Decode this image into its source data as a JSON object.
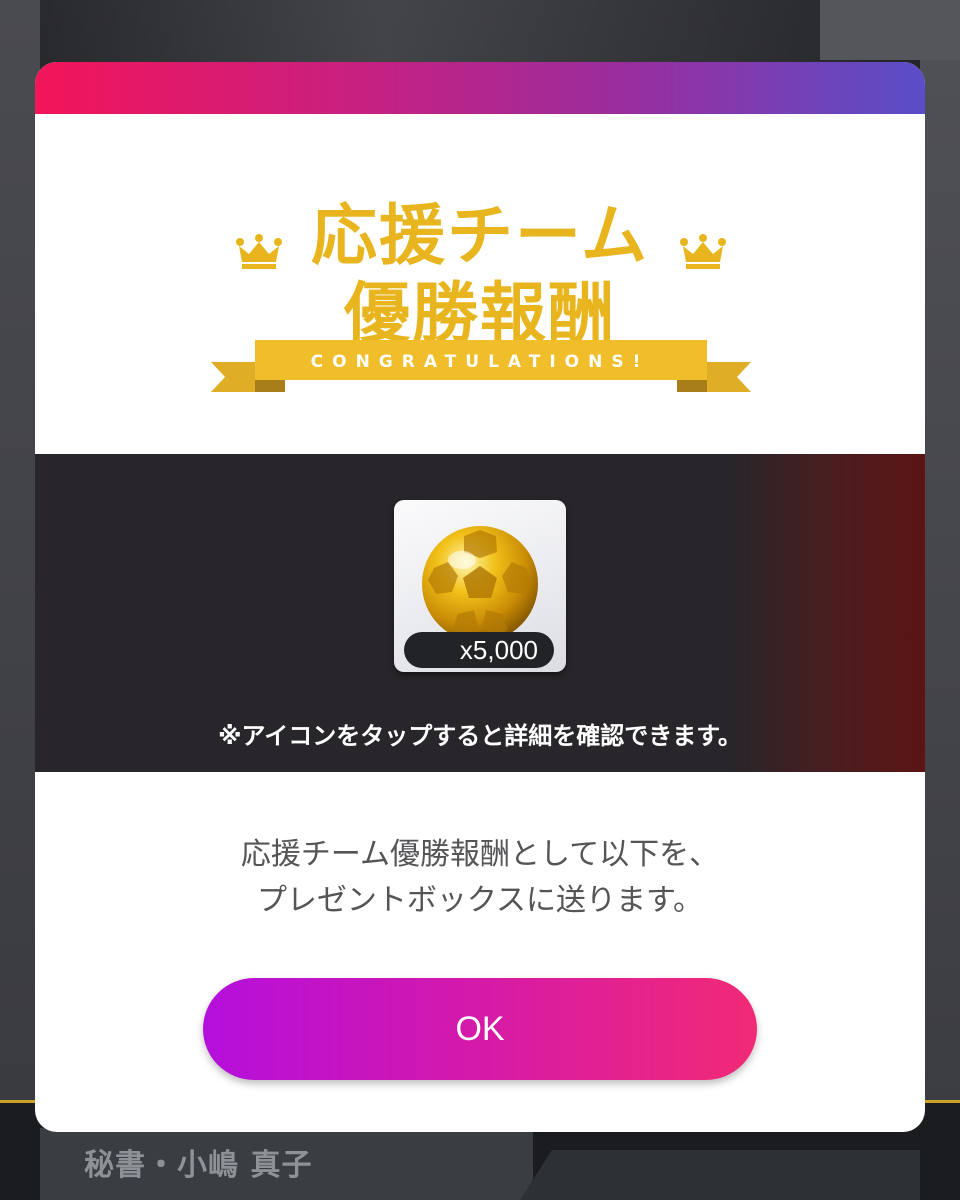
{
  "speaker": {
    "name": "秘書・小嶋 真子"
  },
  "dialog": {
    "title_line1": "応援チーム",
    "title_line2": "優勝報酬",
    "ribbon_text": "CONGRATULATIONS!",
    "reward": {
      "icon": "gold-soccer-ball-icon",
      "quantity": "x5,000"
    },
    "note": "※アイコンをタップすると詳細を確認できます。",
    "message_line1": "応援チーム優勝報酬として以下を、",
    "message_line2": "プレゼントボックスに送ります。",
    "ok_label": "OK"
  },
  "colors": {
    "title_gold": "#e8b51e",
    "topbar_start": "#f2155a",
    "topbar_end": "#5a4ec8",
    "button_start": "#b40fdc",
    "button_end": "#f12a75"
  }
}
